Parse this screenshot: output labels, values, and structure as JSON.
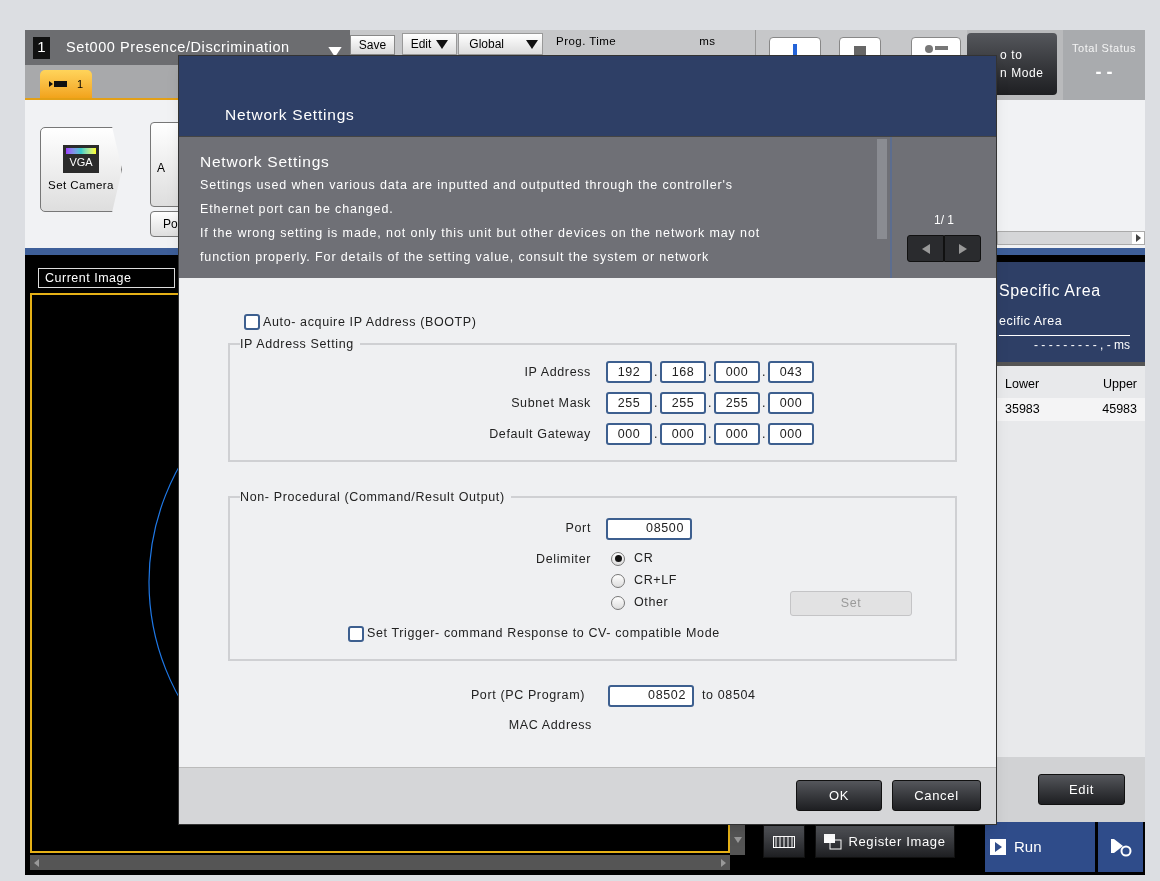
{
  "header": {
    "set_badge": "1",
    "program_title": "Set000 Presence/Discrimination",
    "save": "Save",
    "edit_menu": "Edit",
    "global_menu": "Global",
    "prog_time_label": "Prog. Time",
    "prog_time_unit": "ms",
    "mode_button": [
      "o to",
      "n Mode"
    ],
    "total_status": {
      "label": "Total Status",
      "value": "- -"
    }
  },
  "camera_tabs": [
    {
      "label": "1",
      "selected": true
    }
  ],
  "toolbar": {
    "set_camera": {
      "badge": "VGA",
      "label": "Set Camera"
    },
    "button_2": "A",
    "button_3": "Po"
  },
  "image_view": {
    "dropdown": "Current Image"
  },
  "result_panel": {
    "title": "Specific Area",
    "subtitle": "ecific Area",
    "time": "- - - - - - - - - , - ms",
    "columns": [
      "Lower",
      "Upper"
    ],
    "rows": [
      [
        "35983",
        "45983"
      ]
    ],
    "edit": "Edit"
  },
  "bottom_bar": {
    "register_image": "Register Image",
    "run": "Run"
  },
  "dialog": {
    "title": "Network Settings",
    "help": {
      "heading": "Network Settings",
      "lines": [
        "Settings used when various data are inputted and outputted through the controller's",
        "Ethernet port can be changed.",
        "If the wrong setting is made, not only this unit but other devices on the network may not",
        "function properly. For details of the setting value, consult the system or network"
      ],
      "page": "1/ 1"
    },
    "auto_acquire": {
      "label": "Auto- acquire IP Address (BOOTP)",
      "checked": false
    },
    "ip_group": {
      "legend": "IP Address Setting",
      "separator": ".",
      "rows": [
        {
          "label": "IP Address",
          "octets": [
            "192",
            "168",
            "000",
            "043"
          ]
        },
        {
          "label": "Subnet Mask",
          "octets": [
            "255",
            "255",
            "255",
            "000"
          ]
        },
        {
          "label": "Default Gateway",
          "octets": [
            "000",
            "000",
            "000",
            "000"
          ]
        }
      ]
    },
    "non_procedural": {
      "legend": "Non- Procedural (Command/Result Output)",
      "port_label": "Port",
      "port": "08500",
      "delimiter_label": "Delimiter",
      "delimiters": [
        {
          "label": "CR",
          "selected": true
        },
        {
          "label": "CR+LF",
          "selected": false
        },
        {
          "label": "Other",
          "selected": false
        }
      ],
      "set_button": {
        "label": "Set",
        "disabled": true
      },
      "cv_mode": {
        "label": "Set Trigger- command Response to CV- compatible Mode",
        "checked": false
      }
    },
    "pc_port": {
      "label": "Port (PC Program)",
      "value": "08502",
      "range_end": "to 08504"
    },
    "mac": {
      "label": "MAC Address"
    },
    "buttons": {
      "ok": "OK",
      "cancel": "Cancel"
    }
  }
}
